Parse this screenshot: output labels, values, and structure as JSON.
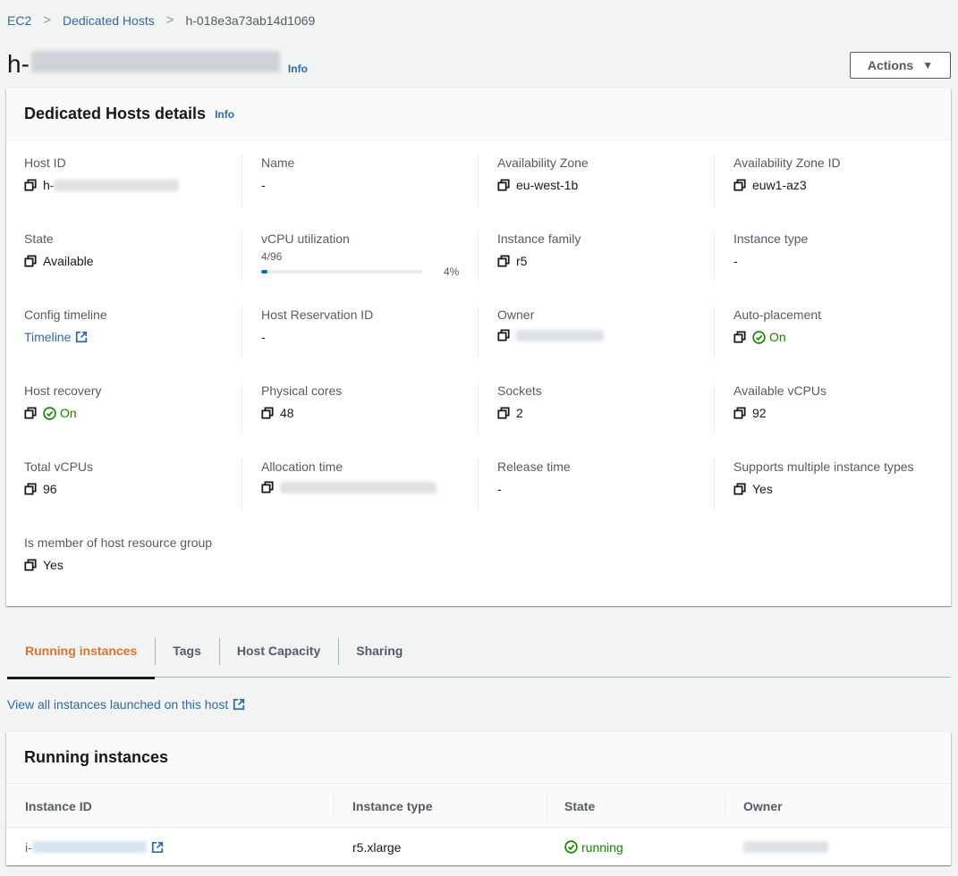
{
  "breadcrumb": {
    "items": [
      {
        "label": "EC2"
      },
      {
        "label": "Dedicated Hosts"
      }
    ],
    "current": "h-018e3a73ab14d1069"
  },
  "header": {
    "title_prefix": "h-",
    "title_redacted": true,
    "info_label": "Info",
    "actions_label": "Actions"
  },
  "details": {
    "title": "Dedicated Hosts details",
    "info_label": "Info",
    "fields": {
      "host_id": {
        "label": "Host ID",
        "value": "h-",
        "redacted": true
      },
      "name": {
        "label": "Name",
        "value": "-"
      },
      "availability_zone": {
        "label": "Availability Zone",
        "value": "eu-west-1b"
      },
      "availability_zone_id": {
        "label": "Availability Zone ID",
        "value": "euw1-az3"
      },
      "state": {
        "label": "State",
        "value": "Available"
      },
      "vcpu_utilization": {
        "label": "vCPU utilization",
        "count": "4/96",
        "percent_label": "4%",
        "percent": 4
      },
      "instance_family": {
        "label": "Instance family",
        "value": "r5"
      },
      "instance_type": {
        "label": "Instance type",
        "value": "-"
      },
      "config_timeline": {
        "label": "Config timeline",
        "value": "Timeline"
      },
      "host_reservation_id": {
        "label": "Host Reservation ID",
        "value": "-"
      },
      "owner": {
        "label": "Owner",
        "redacted": true
      },
      "auto_placement": {
        "label": "Auto-placement",
        "value": "On"
      },
      "host_recovery": {
        "label": "Host recovery",
        "value": "On"
      },
      "physical_cores": {
        "label": "Physical cores",
        "value": "48"
      },
      "sockets": {
        "label": "Sockets",
        "value": "2"
      },
      "available_vcpus": {
        "label": "Available vCPUs",
        "value": "92"
      },
      "total_vcpus": {
        "label": "Total vCPUs",
        "value": "96"
      },
      "allocation_time": {
        "label": "Allocation time",
        "redacted": true
      },
      "release_time": {
        "label": "Release time",
        "value": "-"
      },
      "supports_multiple_types": {
        "label": "Supports multiple instance types",
        "value": "Yes"
      },
      "resource_group_member": {
        "label": "Is member of host resource group",
        "value": "Yes"
      }
    }
  },
  "tabs": [
    {
      "label": "Running instances",
      "active": true
    },
    {
      "label": "Tags",
      "active": false
    },
    {
      "label": "Host Capacity",
      "active": false
    },
    {
      "label": "Sharing",
      "active": false
    }
  ],
  "view_all_link": "View all instances launched on this host",
  "running_instances": {
    "title": "Running instances",
    "columns": [
      "Instance ID",
      "Instance type",
      "State",
      "Owner"
    ],
    "rows": [
      {
        "instance_id": "i-",
        "instance_id_redacted": true,
        "instance_type": "r5.xlarge",
        "state": "running",
        "owner_redacted": true
      }
    ]
  },
  "colors": {
    "link": "#0073bb",
    "success": "#1d8102",
    "active_tab": "#d9742a",
    "progress": "#0073bb"
  }
}
